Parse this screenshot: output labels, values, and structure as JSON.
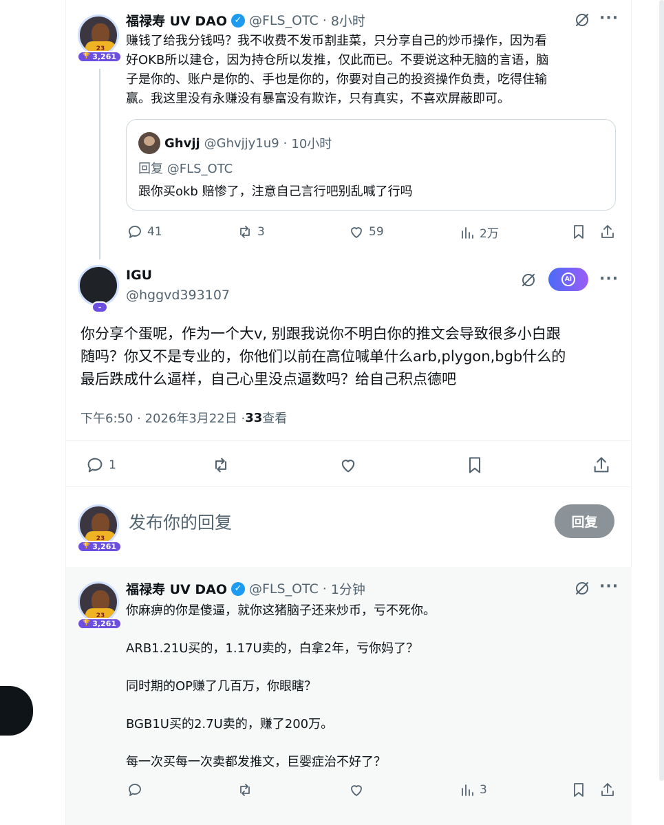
{
  "tweet1": {
    "badge": "3,261",
    "name": "福禄寿 UV DAO",
    "handle": "@FLS_OTC",
    "time": "8小时",
    "text": "赚钱了给我分钱吗？我不收费不发币割韭菜，只分享自己的炒币操作，因为看\n好OKB所以建仓，因为持仓所以发推，仅此而已。不要说这种无脑的言语，脑\n子是你的、账户是你的、手也是你的，你要对自己的投资操作负责，吃得住输\n赢。我这里没有永赚没有暴富没有欺诈，只有真实，不喜欢屏蔽即可。",
    "quote": {
      "name": "Ghvjj",
      "handle": "@Ghvjjy1u9",
      "time": "10小时",
      "reply_to": "回复 @FLS_OTC",
      "text": "跟你买okb 赔惨了，注意自己言行吧别乱喊了行吗"
    },
    "replies": "41",
    "reposts": "3",
    "likes": "59",
    "views": "2万"
  },
  "main_tweet": {
    "badge": "-",
    "name": "IGU",
    "handle": "@hggvd393107",
    "ai_label": "AI",
    "text": "你分享个蛋呢，作为一个大v, 别跟我说你不明白你的推文会导致很多小白跟\n随吗？你又不是专业的，你他们以前在高位喊单什么arb,plygon,bgb什么的\n最后跌成什么逼样，自己心里没点逼数吗？给自己积点德吧",
    "timestamp": "下午6:50 · 2026年3月22日 · ",
    "views_count": "33",
    "views_label": " 查看",
    "replies": "1"
  },
  "composer": {
    "badge": "3,261",
    "placeholder": "发布你的回复",
    "button": "回复"
  },
  "reply": {
    "badge": "3,261",
    "name": "福禄寿 UV DAO",
    "handle": "@FLS_OTC",
    "time": "1分钟",
    "lines": [
      "你麻痹的你是傻逼，就你这猪脑子还来炒币，亏不死你。",
      "ARB1.21U买的，1.17U卖的，白拿2年，亏你妈了？",
      "同时期的OP赚了几百万，你眼瞎？",
      "BGB1U买的2.7U卖的，赚了200万。",
      "每一次买每一次卖都发推文，巨婴症治不好了？"
    ],
    "views": "3"
  },
  "separator": " · ",
  "jersey_number": "23",
  "colors": {
    "accent": "#1d9bf0",
    "badge": "#6c4fe0",
    "muted": "#536471"
  }
}
